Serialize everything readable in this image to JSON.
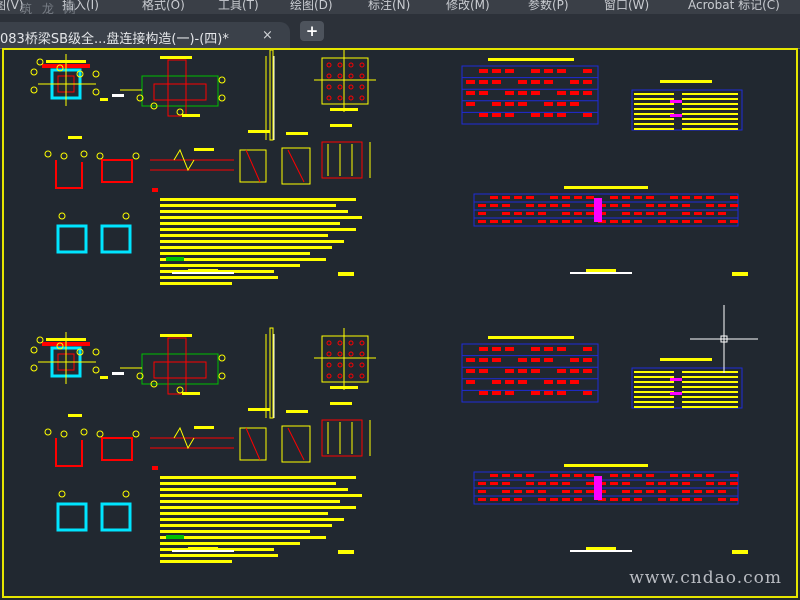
{
  "menubar": {
    "items": [
      "图(V)",
      "插入(I)",
      "格式(O)",
      "工具(T)",
      "绘图(D)",
      "标注(N)",
      "修改(M)",
      "参数(P)",
      "窗口(W)",
      "Acrobat 标记(C)"
    ]
  },
  "watermark_top": "筑 龙 网",
  "tabs": {
    "doc_title": "083桥梁SB级全...盘连接构造(一)-(四)*",
    "close_glyph": "×",
    "new_tab_glyph": "+"
  },
  "watermark_bottom": "www.cndao.com",
  "colors": {
    "canvas_bg": "#212830",
    "yellow": "#ffff00",
    "red": "#ff0000",
    "cyan": "#00e5ff",
    "blue": "#1f2bd8",
    "magenta": "#ff00ff",
    "green": "#00c000",
    "white": "#ffffff"
  },
  "icons": [
    "close-icon",
    "plus-icon",
    "crosshair-cursor-icon"
  ]
}
